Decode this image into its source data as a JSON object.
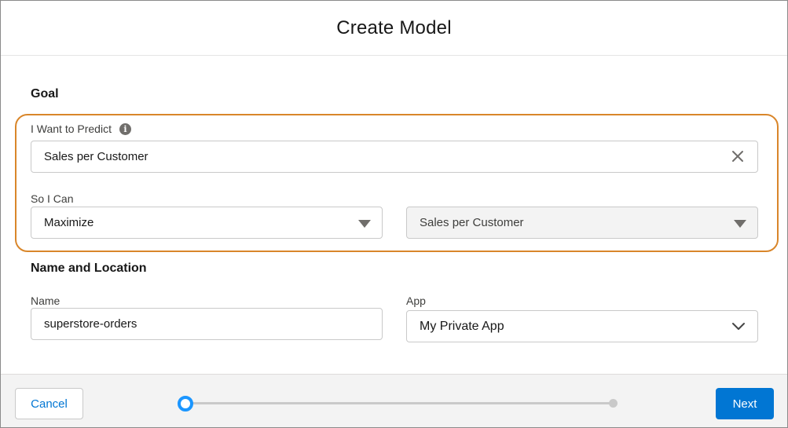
{
  "modal": {
    "title": "Create Model"
  },
  "goal": {
    "section_title": "Goal",
    "predict_label": "I Want to Predict",
    "predict_value": "Sales per Customer",
    "so_i_can_label": "So I Can",
    "action_value": "Maximize",
    "target_value": "Sales per Customer"
  },
  "name_location": {
    "section_title": "Name and Location",
    "name_label": "Name",
    "name_value": "superstore-orders",
    "app_label": "App",
    "app_value": "My Private App"
  },
  "footer": {
    "cancel_label": "Cancel",
    "next_label": "Next",
    "progress": {
      "current_step": 1,
      "total_steps": 2
    }
  },
  "colors": {
    "brand": "#0176d3",
    "progress_active": "#1b96ff",
    "highlight": "#d9862a"
  },
  "icons": {
    "info": "info-icon",
    "clear": "close-icon",
    "dropdown": "caret-down-icon",
    "chevron": "chevron-down-icon"
  }
}
